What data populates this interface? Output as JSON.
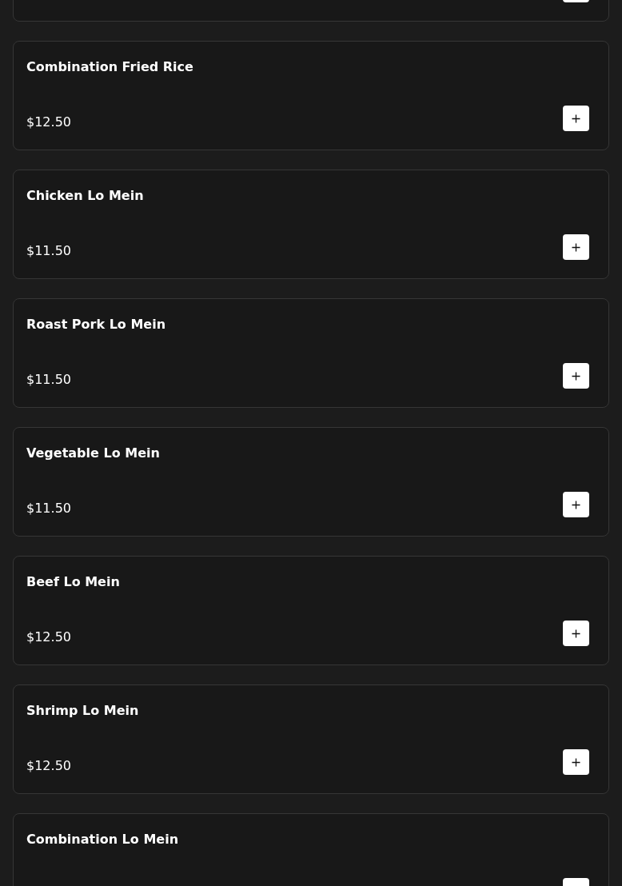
{
  "menu_items": [
    {
      "name": "Combination Fried Rice",
      "price": "$12.50"
    },
    {
      "name": "Chicken Lo Mein",
      "price": "$11.50"
    },
    {
      "name": "Roast Pork Lo Mein",
      "price": "$11.50"
    },
    {
      "name": "Vegetable Lo Mein",
      "price": "$11.50"
    },
    {
      "name": "Beef Lo Mein",
      "price": "$12.50"
    },
    {
      "name": "Shrimp Lo Mein",
      "price": "$12.50"
    },
    {
      "name": "Combination Lo Mein"
    }
  ]
}
